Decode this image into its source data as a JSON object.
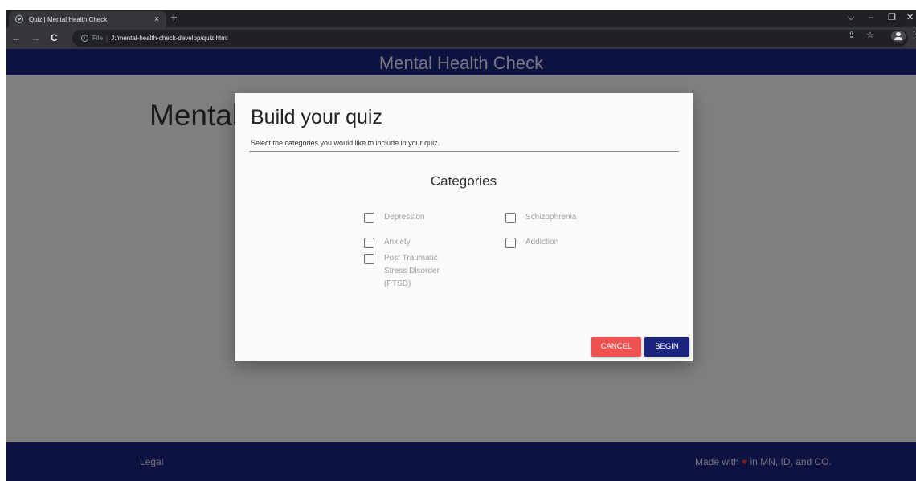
{
  "browser": {
    "tab_title": "Quiz | Mental Health Check",
    "tab_close": "×",
    "new_tab": "+",
    "address": {
      "scheme_label": "File",
      "separator": "|",
      "url": "J:/mental-health-check-develop/quiz.html"
    },
    "icons": {
      "back": "←",
      "forward": "→",
      "reload": "C",
      "info": "i",
      "share": "⇪",
      "bookmark": "☆",
      "menu": "⋮",
      "dropdown": "⌵",
      "minimize": "–",
      "restore": "❐",
      "close": "✕"
    }
  },
  "site": {
    "header_title": "Mental Health Check",
    "page_heading": "Mental Health Check",
    "footer": {
      "legal": "Legal",
      "made_prefix": "Made with",
      "heart": "♥",
      "made_suffix": "in MN, ID, and CO."
    }
  },
  "modal": {
    "title": "Build your quiz",
    "subtitle": "Select the categories you would like to include in your quiz.",
    "section_title": "Categories",
    "categories": [
      {
        "label": "Depression",
        "checked": false
      },
      {
        "label": "Schizophrenia",
        "checked": false
      },
      {
        "label": "Anxiety",
        "checked": false
      },
      {
        "label": "Addiction",
        "checked": false
      },
      {
        "label": "Post Traumatic Stress Disorder (PTSD)",
        "checked": false
      }
    ],
    "cancel_label": "CANCEL",
    "begin_label": "BEGIN"
  },
  "colors": {
    "brand_navy": "#1a237e",
    "cancel_red": "#ef5350",
    "overlay": "rgba(0,0,0,0.48)"
  }
}
